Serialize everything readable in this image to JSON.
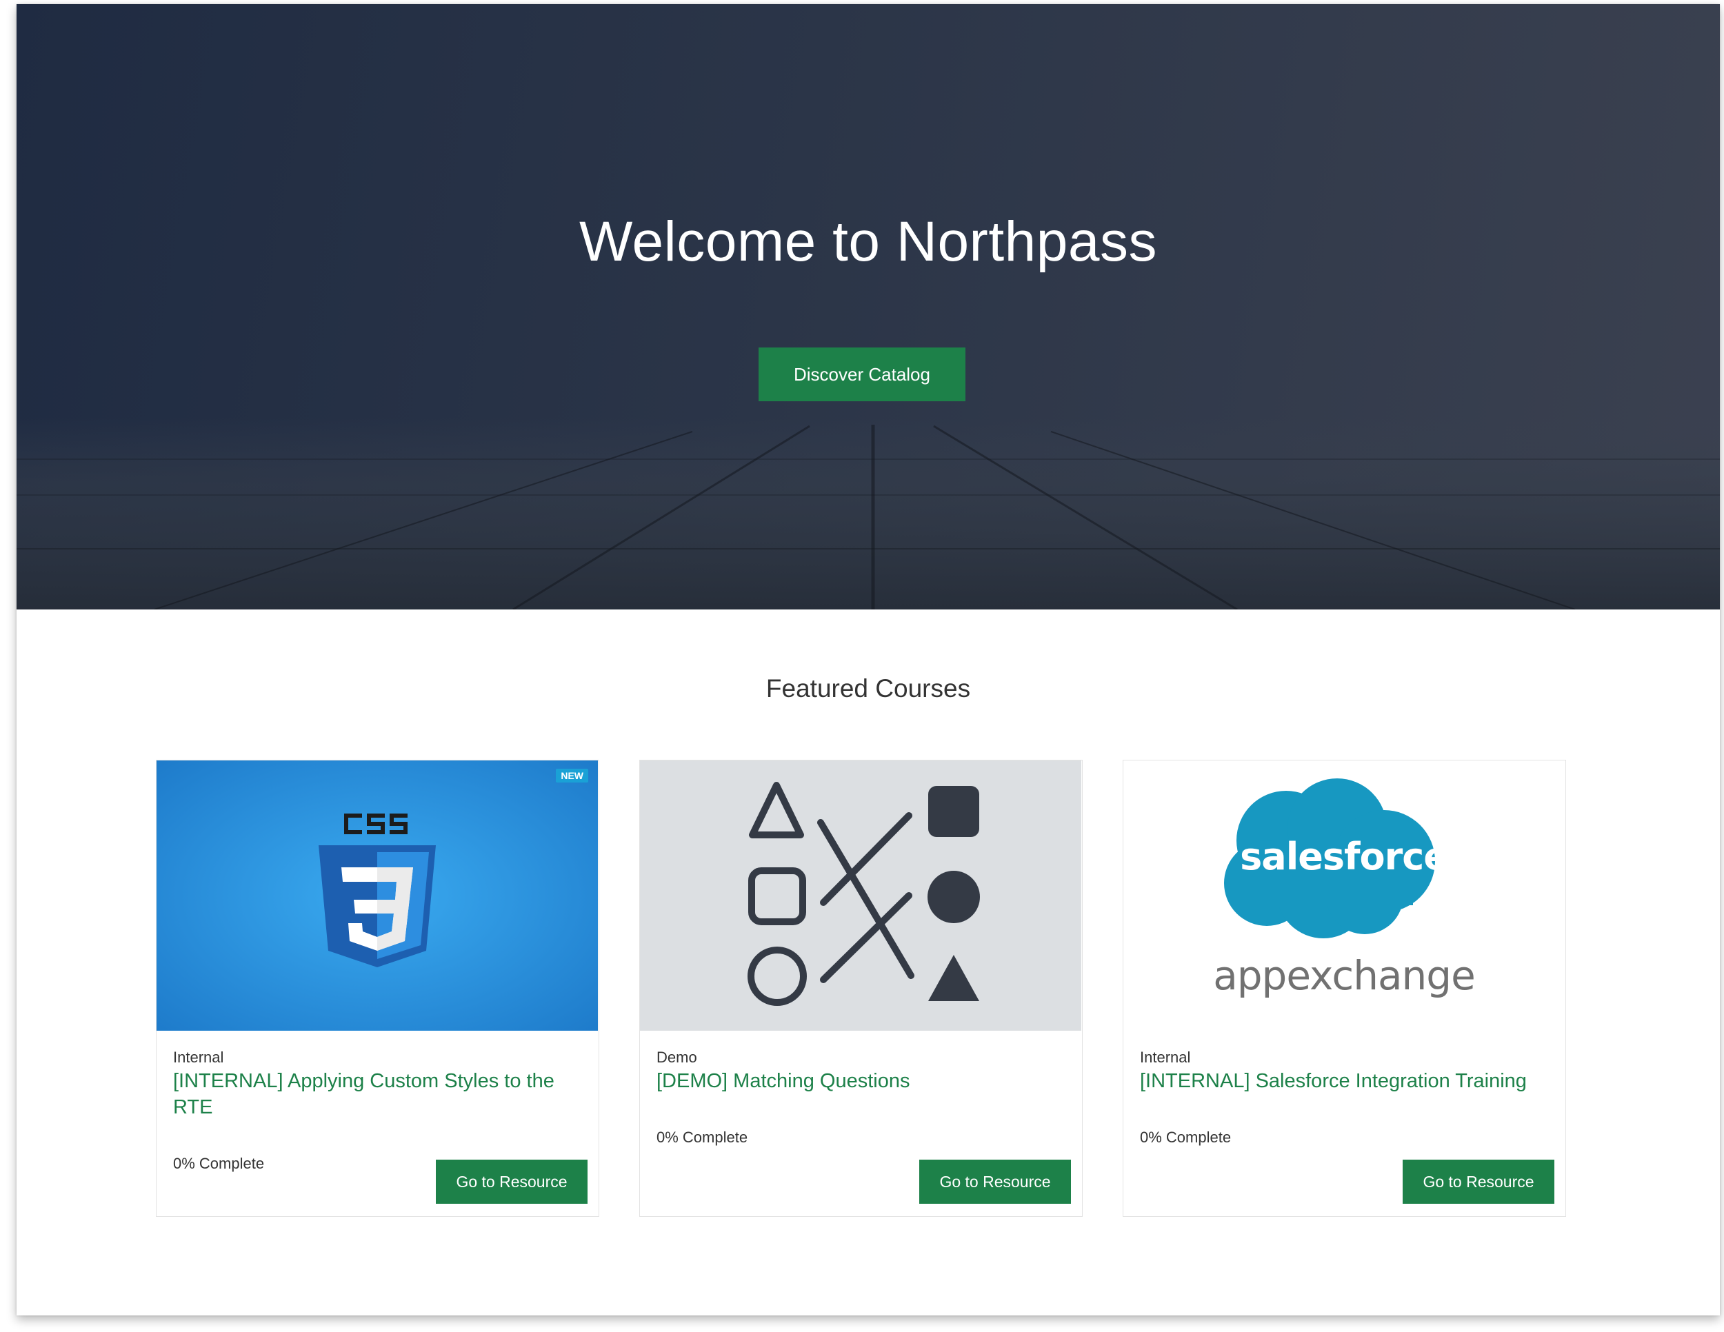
{
  "hero": {
    "title": "Welcome to Northpass",
    "cta_label": "Discover Catalog"
  },
  "featured": {
    "heading": "Featured Courses",
    "cards": [
      {
        "category": "Internal",
        "title": "[INTERNAL] Applying Custom Styles to the RTE",
        "progress": "0% Complete",
        "button_label": "Go to Resource",
        "badge": "NEW",
        "image_icon": "css3-logo",
        "image_text": "CSS"
      },
      {
        "category": "Demo",
        "title": "[DEMO] Matching Questions",
        "progress": "0% Complete",
        "button_label": "Go to Resource",
        "image_icon": "matching-shapes-illustration"
      },
      {
        "category": "Internal",
        "title": "[INTERNAL] Salesforce Integration Training",
        "progress": "0% Complete",
        "button_label": "Go to Resource",
        "image_icon": "salesforce-appexchange-logo",
        "image_text": "salesforce",
        "image_subtext": "appexchange"
      }
    ]
  },
  "colors": {
    "accent": "#1d8149",
    "hero_bg": "#2b3548",
    "badge": "#1aa1d6",
    "css_blue": "#2a8fd8",
    "salesforce_blue": "#1798c1"
  }
}
